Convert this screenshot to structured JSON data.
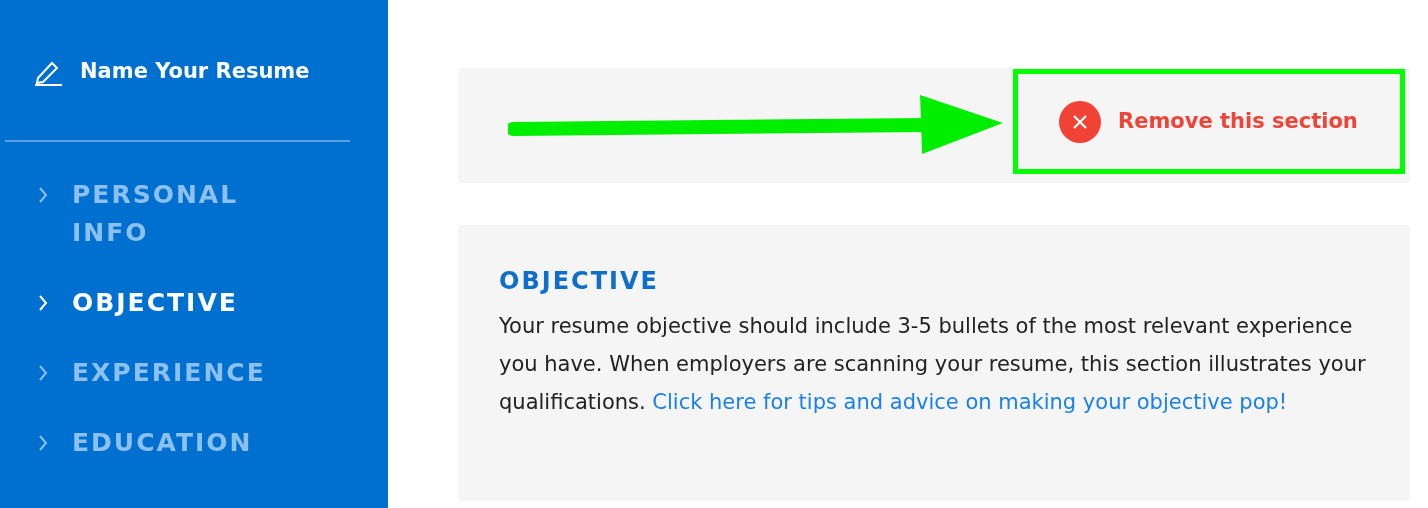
{
  "sidebar": {
    "title": "Name Your Resume",
    "items": [
      {
        "label": "PERSONAL INFO",
        "selected": false
      },
      {
        "label": "OBJECTIVE",
        "selected": true
      },
      {
        "label": "EXPERIENCE",
        "selected": false
      },
      {
        "label": "EDUCATION",
        "selected": false
      }
    ]
  },
  "section_bar": {
    "remove_button": "Remove this section",
    "highlighted": true
  },
  "objective": {
    "heading": "OBJECTIVE",
    "text": "Your resume objective should include 3-5 bullets of the most relevant experience you have. When employers are scanning your resume, this section illustrates your qualifications.",
    "link": "Click here for tips and advice on making your objective pop!"
  }
}
